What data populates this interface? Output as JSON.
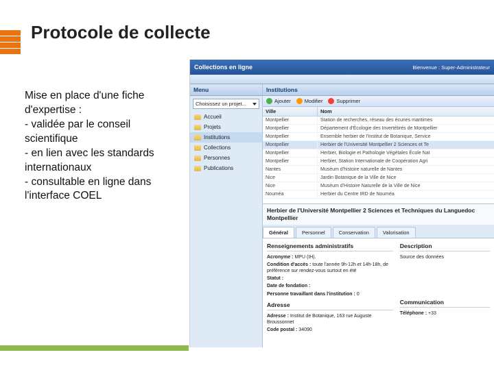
{
  "slide": {
    "title": "Protocole de collecte",
    "body": "Mise en place d'une fiche d'expertise :\n - validée par le conseil scientifique\n- en lien avec les standards internationaux\n- consultable en ligne dans l'interface COEL"
  },
  "app": {
    "title": "Collections en ligne",
    "welcome": "Bienvenue : Super-Administrateur",
    "sidebar": {
      "menu_label": "Menu",
      "project_placeholder": "Choisissez un projet...",
      "items": [
        {
          "label": "Accueil"
        },
        {
          "label": "Projets"
        },
        {
          "label": "Institutions"
        },
        {
          "label": "Collections"
        },
        {
          "label": "Personnes"
        },
        {
          "label": "Publications"
        }
      ]
    },
    "content": {
      "panel_title": "Institutions",
      "toolbar": {
        "add": "Ajouter",
        "mod": "Modifier",
        "del": "Supprimer"
      },
      "grid": {
        "col1": "Ville",
        "col2": "Nom",
        "rows": [
          {
            "ville": "Montpellier",
            "nom": "Station de recherches, réseau des écuries maritimes"
          },
          {
            "ville": "Montpellier",
            "nom": "Département d'Écologie des Invertébrés de Montpellier"
          },
          {
            "ville": "Montpellier",
            "nom": "Ensemble herbier de l'Institut de Botanique, Service"
          },
          {
            "ville": "Montpellier",
            "nom": "Herbier de l'Université Montpellier 2 Sciences et Te"
          },
          {
            "ville": "Montpellier",
            "nom": "Herbier, Biologie et Pathologie Végétales École Nat"
          },
          {
            "ville": "Montpellier",
            "nom": "Herbier, Station Internationale de Coopération Agri"
          },
          {
            "ville": "Nantes",
            "nom": "Muséum d'histoire naturelle de Nantes"
          },
          {
            "ville": "Nice",
            "nom": "Jardin Botanique de la Ville de Nice"
          },
          {
            "ville": "Nice",
            "nom": "Muséum d'Histoire Naturelle de la Ville de Nice"
          },
          {
            "ville": "Nouméa",
            "nom": "Herbier du Centre IRD de Nouméa"
          }
        ]
      },
      "detail_heading": "Herbier de l'Université Montpellier 2 Sciences et Techniques du Languedoc Montpellier",
      "tabs": [
        {
          "label": "Général",
          "active": true
        },
        {
          "label": "Personnel",
          "active": false
        },
        {
          "label": "Conservation",
          "active": false
        },
        {
          "label": "Valorisation",
          "active": false
        }
      ],
      "admin": {
        "title": "Renseignements administratifs",
        "acronyme_label": "Acronyme :",
        "acronyme_value": "MPU (IH).",
        "condition_label": "Condition d'accès :",
        "condition_value": "toute l'année 9h-12h et 14h-18h, de préférence sur rendez-vous surtout en été",
        "statut_label": "Statut :",
        "date_label": "Date de fondation :",
        "personne_label": "Personne travaillant dans l'institution :",
        "personne_value": "0"
      },
      "desc": {
        "title": "Description",
        "text": "Source des données"
      },
      "adresse": {
        "title": "Adresse",
        "adresse_label": "Adresse :",
        "adresse_value": "Institut de Botanique, 163 rue Auguste Broussonnet",
        "cp_label": "Code postal :",
        "cp_value": "34090"
      },
      "comm": {
        "title": "Communication",
        "tel_label": "Téléphone :",
        "tel_value": "+33"
      }
    }
  }
}
